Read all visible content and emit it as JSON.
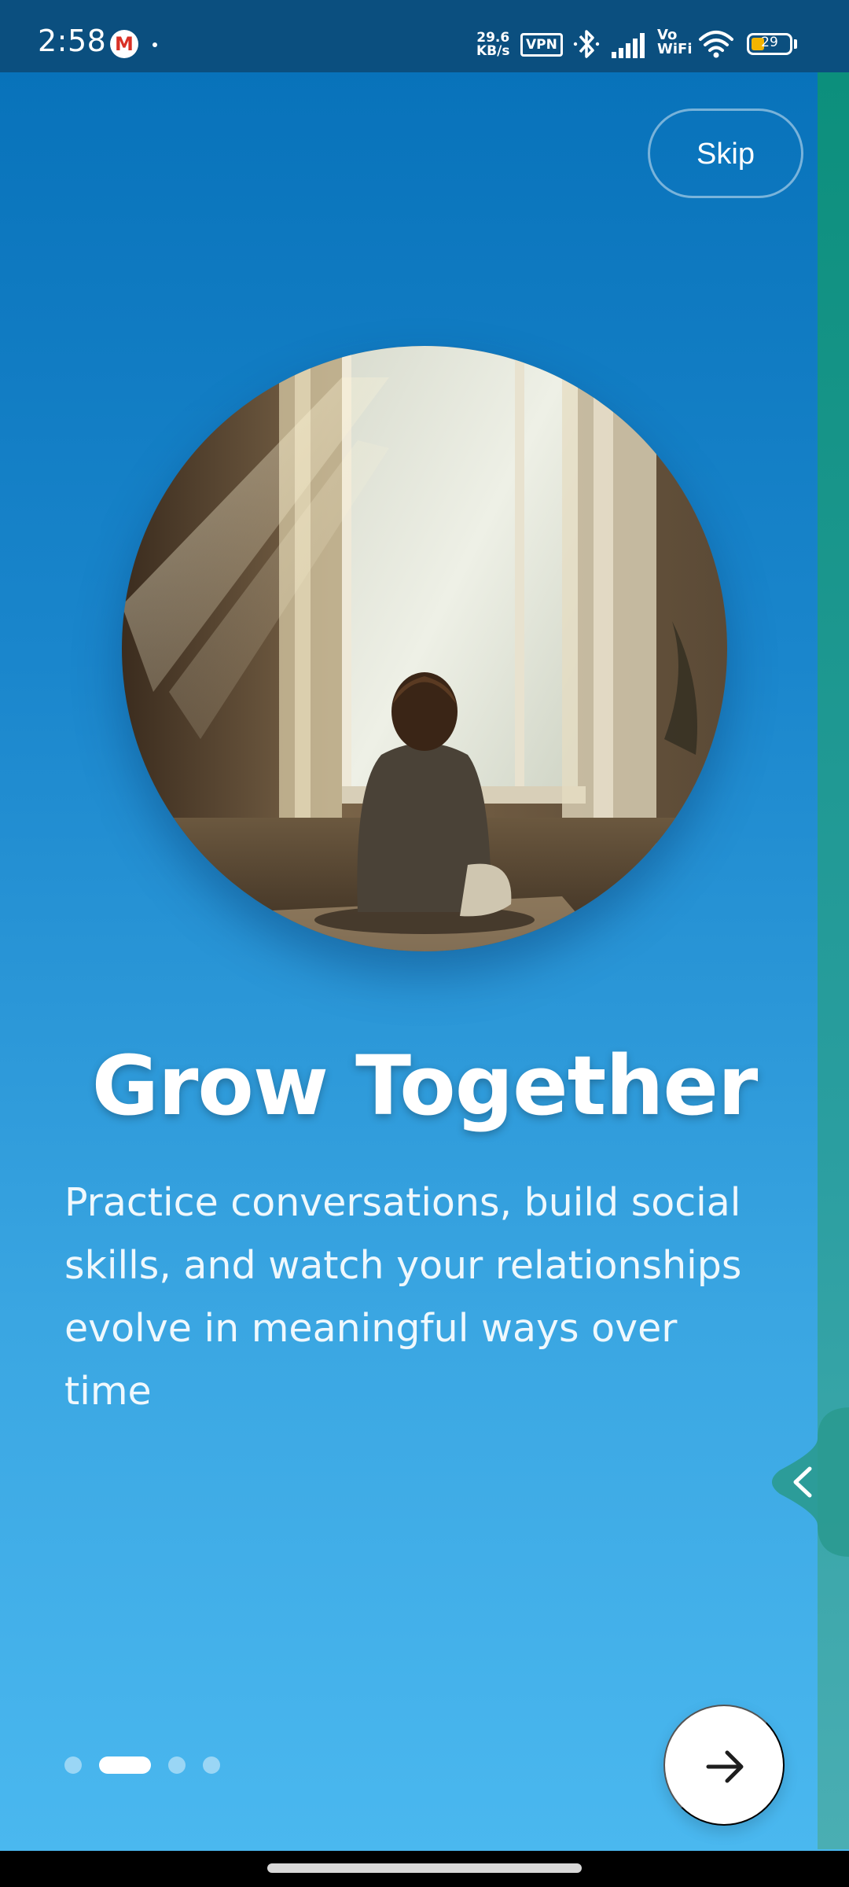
{
  "status_bar": {
    "time": "2:58",
    "net_speed_value": "29.6",
    "net_speed_unit": "KB/s",
    "vpn_label": "VPN",
    "vowifi_line1": "Vo",
    "vowifi_line2": "WiFi",
    "battery_level": "29",
    "icons": [
      "gmail-icon",
      "bluetooth-icon",
      "signal-icon",
      "wifi-icon",
      "battery-icon"
    ]
  },
  "onboarding": {
    "skip_label": "Skip",
    "title": "Grow Together",
    "description_lines": [
      "Practice conversations, build social",
      "skills, and watch your relationships",
      "evolve in meaningful ways over",
      "time"
    ],
    "page_count": 4,
    "current_page": 2,
    "next_icon": "arrow-right-icon"
  },
  "edge_panel": {
    "handle_icon": "chevron-left-icon"
  },
  "colors": {
    "gradient_top": "#0670b8",
    "gradient_bottom": "#4bb9f0",
    "status_bar": "#0b4f7f",
    "edge_panel": "#0c8f7c"
  }
}
